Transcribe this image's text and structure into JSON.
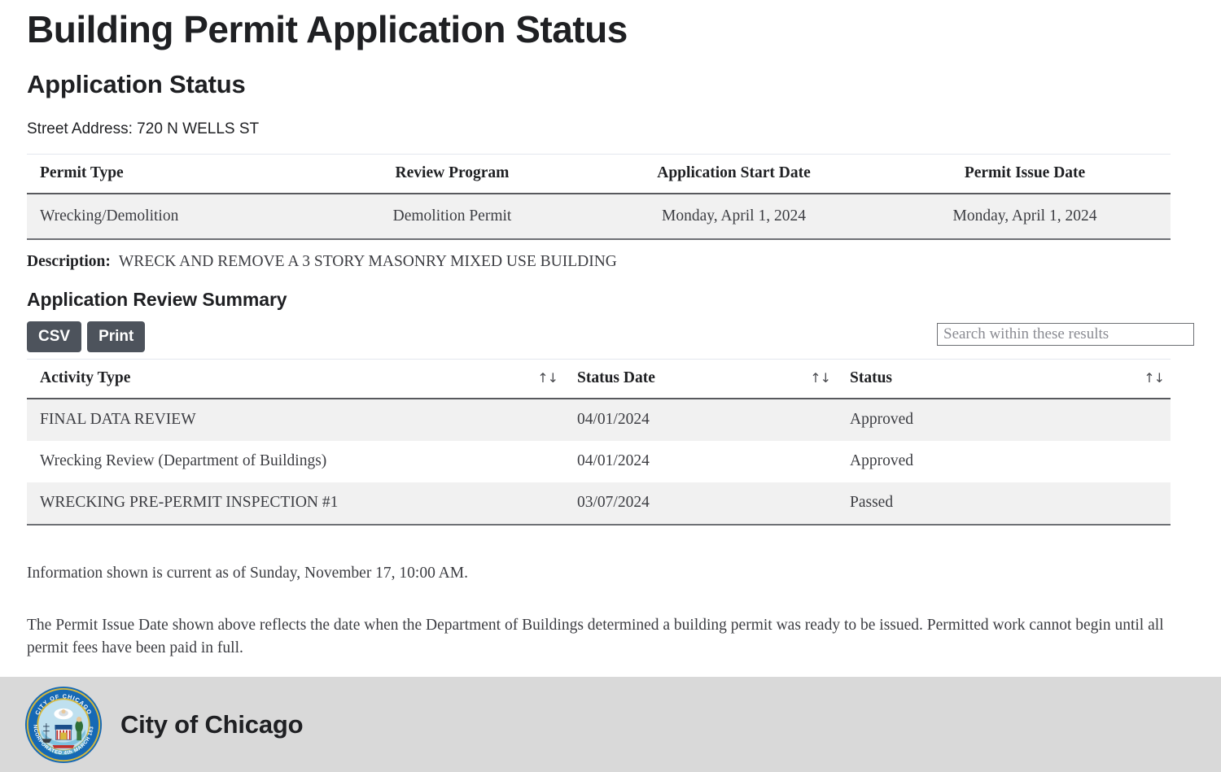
{
  "page": {
    "title": "Building Permit Application Status",
    "section_title": "Application Status",
    "street_address": "Street Address: 720 N WELLS ST"
  },
  "permit_table": {
    "columns": [
      "Permit Type",
      "Review Program",
      "Application Start Date",
      "Permit Issue Date"
    ],
    "rows": [
      {
        "permit_type": "Wrecking/Demolition",
        "review_program": "Demolition Permit",
        "application_start_date": "Monday, April 1, 2024",
        "permit_issue_date": "Monday, April 1, 2024"
      }
    ]
  },
  "description": {
    "label": "Description:",
    "value": "WRECK AND REMOVE A 3 STORY MASONRY MIXED USE BUILDING"
  },
  "review_summary": {
    "title": "Application Review Summary",
    "toolbar": {
      "csv_label": "CSV",
      "print_label": "Print",
      "search_placeholder": "Search within these results",
      "search_value": ""
    },
    "columns": [
      "Activity Type",
      "Status Date",
      "Status"
    ],
    "sort_icon": "↑↓",
    "rows": [
      {
        "activity_type": "FINAL DATA REVIEW",
        "status_date": "04/01/2024",
        "status": "Approved"
      },
      {
        "activity_type": "Wrecking Review (Department of Buildings)",
        "status_date": "04/01/2024",
        "status": "Approved"
      },
      {
        "activity_type": "WRECKING PRE-PERMIT INSPECTION #1",
        "status_date": "03/07/2024",
        "status": "Passed"
      }
    ]
  },
  "notes": {
    "current_as_of": "Information shown is current as of Sunday, November 17, 10:00 AM.",
    "permit_issue_note": "The Permit Issue Date shown above reflects the date when the Department of Buildings determined a building permit was ready to be issued. Permitted work cannot begin until all permit fees have been paid in full."
  },
  "footer": {
    "seal_alt": "city-of-chicago-seal",
    "seal_outer_text": "CITY OF CHICAGO",
    "seal_lower_text": "INCORPORATED 4th MARCH 1837",
    "title": "City of Chicago"
  },
  "colors": {
    "button_bg": "#4d535c",
    "row_stripe": "#f1f1f1",
    "footer_bg": "#d9d9d9",
    "rule": "#6e7075",
    "seal_ring": "#1669b5",
    "seal_gold": "#d7b93c"
  }
}
